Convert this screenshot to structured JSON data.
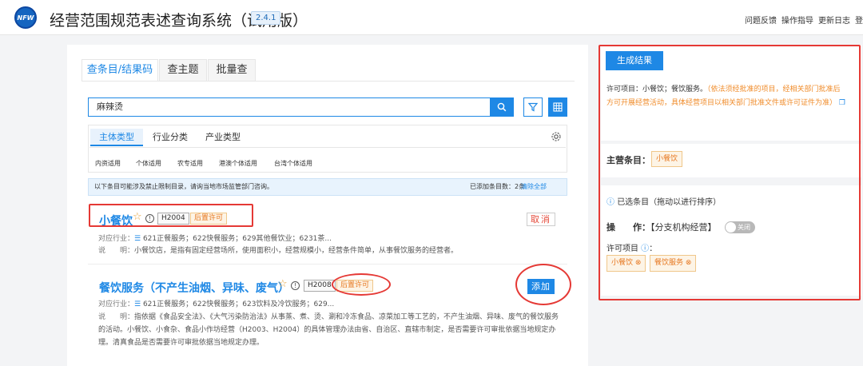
{
  "header": {
    "logo_text": "NFW",
    "title": "经营范围规范表述查询系统（试用版）",
    "version": "2.4.1",
    "links": [
      "问题反馈",
      "操作指导",
      "更新日志",
      "登"
    ]
  },
  "search": {
    "tabs": [
      "查条目/结果码",
      "查主题",
      "批量查"
    ],
    "query": "麻辣烫",
    "subtabs": [
      "主体类型",
      "行业分类",
      "产业类型"
    ],
    "chips": [
      "内资适用",
      "个体适用",
      "农专适用",
      "港澳个体适用",
      "台湾个体适用"
    ],
    "notice": "以下条目可能涉及禁止限制目录，请询当地市场监管部门咨询。",
    "added_count": "已添加条目数：2条",
    "clear_all": "清除全部"
  },
  "results": [
    {
      "title": "小餐饮",
      "code": "H2004",
      "permit": "后置许可",
      "action": "取消",
      "industry_label": "对应行业：",
      "industry": "621正餐服务；622快餐服务；629其他餐饮业；6231茶...",
      "desc_label": "说　　明：",
      "desc": "小餐饮店，是指有固定经营场所，使用面积小，经营规模小，经营条件简单，从事餐饮服务的经营者。"
    },
    {
      "title": "餐饮服务（不产生油烟、异味、废气）",
      "code": "H2008",
      "permit": "后置许可",
      "action": "添加",
      "industry_label": "对应行业：",
      "industry": "621正餐服务；622快餐服务；623饮料及冷饮服务；629...",
      "desc_label": "说　　明：",
      "desc": "指依据《食品安全法》、《大气污染防治法》从事蒸、煮、烫、涮和冷冻食品、凉菜加工等工艺的，不产生油烟、异味、废气的餐饮服务的活动。小餐饮、小食杂、食品小作坊经营（H2003、H2004）的具体管理办法由省、自治区、直辖市制定，是否需要许可审批依据当地规定办理。清真食品是否需要许可审批依据当地规定办理。"
    }
  ],
  "result_panel": {
    "generate_label": "生成结果",
    "result_text": "许可项目：小餐饮；餐饮服务。",
    "result_note": "（依法须经批准的项目，经相关部门批准后方可开展经营活动，具体经营项目以相关部门批准文件或许可证件为准）",
    "main_label": "主营条目：",
    "main_item": "小餐饮",
    "selected_title": "已选条目（拖动以进行排序）",
    "op_label": "操　　作：",
    "branch_label": "【分支机构经营】",
    "toggle_text": "关闭",
    "permit_label": "许可项目",
    "selected_items": [
      "小餐饮",
      "餐饮服务"
    ]
  },
  "colors": {
    "primary": "#1e88e5",
    "warning": "#e6761e",
    "annotation": "#e53935"
  }
}
